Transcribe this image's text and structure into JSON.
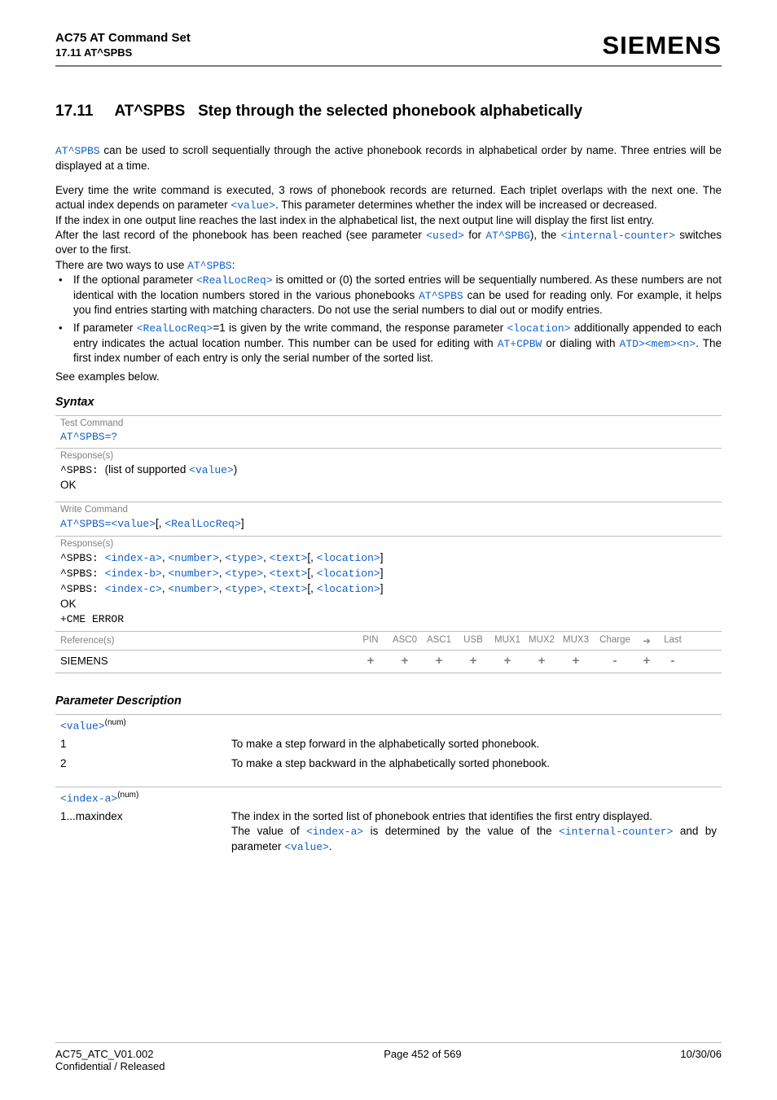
{
  "header": {
    "title": "AC75 AT Command Set",
    "sub": "17.11 AT^SPBS",
    "brand": "SIEMENS"
  },
  "section": {
    "number": "17.11",
    "title_prefix": "AT^SPBS",
    "title_rest": "Step through the selected phonebook alphabetically"
  },
  "intro": {
    "cmd": "AT^SPBS",
    "intro_rest": " can be used to scroll sequentially through the active phonebook records in alphabetical order by name. Three entries will be displayed at a time.",
    "p2a": "Every time the write command is executed, 3 rows of phonebook records are returned. Each triplet overlaps with the next one. The actual index depends on parameter ",
    "p2_value": "<value>",
    "p2b": ". This parameter determines whether the index will be increased or decreased.",
    "p3": "If the index in one output line reaches the last index in the alphabetical list, the next output line will display the first list entry.",
    "p4a": "After the last record of the phonebook has been reached (see parameter ",
    "p4_used": "<used>",
    "p4_for": " for ",
    "p4_cmd": "AT^SPBG",
    "p4b": "), the ",
    "p4_ic": "<internal-counter>",
    "p4c": " switches over to the first.",
    "p5a": "There are two ways to use ",
    "p5_cmd": "AT^SPBS",
    "p5b": ":"
  },
  "bullets": {
    "b1a": "If the optional parameter ",
    "b1_rlr": "<RealLocReq>",
    "b1b": " is omitted or (0) the sorted entries will be sequentially numbered. As these numbers are not identical with the location numbers stored in the various phonebooks ",
    "b1_cmd": "AT^SPBS",
    "b1c": " can be used for reading only. For example, it helps you find entries starting with matching characters. Do not use the serial numbers to dial out or modify entries.",
    "b2a": "If parameter ",
    "b2_rlr": "<RealLocReq>",
    "b2b": "=1 is given by the write command, the response parameter ",
    "b2_loc": "<location>",
    "b2c": " additionally appended to each entry indicates the actual location number. This number can be used for editing with ",
    "b2_cpbw": "AT+CPBW",
    "b2d": " or dialing with ",
    "b2_atd": "ATD><mem><n>",
    "b2e": ". The first index number of each entry is only the serial number of the sorted list."
  },
  "see_examples": "See examples below.",
  "syntax": {
    "heading": "Syntax",
    "test_cmd_label": "Test Command",
    "test_cmd": "AT^SPBS=?",
    "response_label": "Response(s)",
    "test_resp_prefix": "^SPBS: ",
    "test_resp_text": "(list of supported ",
    "test_resp_value": "<value>",
    "test_resp_close": ")",
    "ok": "OK",
    "write_cmd_label": "Write Command",
    "write_cmd_prefix": "AT^SPBS=",
    "write_cmd_value": "<value>",
    "write_cmd_open": "[, ",
    "write_cmd_rlr": "<RealLocReq>",
    "write_cmd_close": "]",
    "resp_prefix": "^SPBS: ",
    "index_a": "<index-a>",
    "index_b": "<index-b>",
    "index_c": "<index-c>",
    "number": "<number>",
    "type": "<type>",
    "text": "<text>",
    "location": "<location>",
    "comma": ", ",
    "obracket": "[, ",
    "cbracket": "]",
    "cme": "+CME ERROR",
    "ref_label": "Reference(s)",
    "cols": [
      "PIN",
      "ASC0",
      "ASC1",
      "USB",
      "MUX1",
      "MUX2",
      "MUX3",
      "Charge",
      "➔",
      "Last"
    ],
    "ref_value": "SIEMENS",
    "row_values": [
      "+",
      "+",
      "+",
      "+",
      "+",
      "+",
      "+",
      "-",
      "+",
      "-"
    ]
  },
  "paramdesc": {
    "heading": "Parameter Description",
    "value_name": "<value>",
    "num_sup": "(num)",
    "val1": "1",
    "val1_desc": "To make a step forward in the alphabetically sorted phonebook.",
    "val2": "2",
    "val2_desc": "To make a step backward in the alphabetically sorted phonebook.",
    "indexa_name": "<index-a>",
    "range": "1...maxindex",
    "indexa_desc1": "The index in the sorted list of phonebook entries that identifies the first entry displayed.",
    "indexa_desc2a": "The value of ",
    "indexa_ref1": "<index-a>",
    "indexa_desc2b": " is determined by the value of the ",
    "indexa_ref2": "<internal-counter>",
    "indexa_desc2c": " and by parameter ",
    "indexa_ref3": "<value>",
    "indexa_desc2d": "."
  },
  "footer": {
    "left1": "AC75_ATC_V01.002",
    "left2": "Confidential / Released",
    "center": "Page 452 of 569",
    "right": "10/30/06"
  }
}
